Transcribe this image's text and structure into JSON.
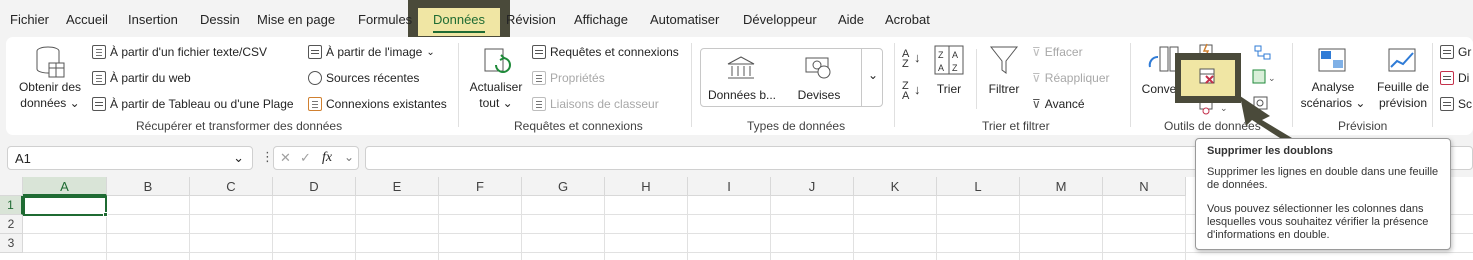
{
  "menu": {
    "tabs": [
      "Fichier",
      "Accueil",
      "Insertion",
      "Dessin",
      "Mise en page",
      "Formules",
      "Données",
      "Révision",
      "Affichage",
      "Automatiser",
      "Développeur",
      "Aide",
      "Acrobat"
    ]
  },
  "ribbon": {
    "get_data": {
      "big_line1": "Obtenir des",
      "big_line2": "données",
      "from_text": "À partir d'un fichier texte/CSV",
      "from_web": "À partir du web",
      "from_table": "À partir de Tableau ou d'une Plage",
      "from_image": "À partir de l'image",
      "recent_sources": "Sources récentes",
      "existing_connections": "Connexions existantes",
      "group_label": "Récupérer et transformer des données"
    },
    "queries": {
      "refresh_line1": "Actualiser",
      "refresh_line2": "tout",
      "queries_connections": "Requêtes et connexions",
      "properties": "Propriétés",
      "workbook_links": "Liaisons de classeur",
      "group_label": "Requêtes et connexions"
    },
    "data_types": {
      "stocks": "Données b...",
      "currencies": "Devises",
      "group_label": "Types de données"
    },
    "sort_filter": {
      "sort": "Trier",
      "filter": "Filtrer",
      "clear": "Effacer",
      "reapply": "Réappliquer",
      "advanced": "Avancé",
      "group_label": "Trier et filtrer"
    },
    "data_tools": {
      "convert": "Convertir",
      "group_label": "Outils de données"
    },
    "forecast": {
      "whatif_line1": "Analyse",
      "whatif_line2": "scénarios",
      "sheet_line1": "Feuille de",
      "sheet_line2": "prévision",
      "group_label": "Prévision"
    },
    "outline": {
      "group_items": [
        "Gr",
        "Di",
        "Sc"
      ]
    }
  },
  "formula_bar": {
    "name_box": "A1",
    "fx": "fx",
    "formula": ""
  },
  "grid": {
    "columns": [
      "A",
      "B",
      "C",
      "D",
      "E",
      "F",
      "G",
      "H",
      "I",
      "J",
      "K",
      "L",
      "M",
      "N"
    ],
    "rows": [
      "1",
      "2",
      "3"
    ]
  },
  "tooltip": {
    "title": "Supprimer les doublons",
    "para1": "Supprimer les lignes en double dans une feuille de données.",
    "para2": "Vous pouvez sélectionner les colonnes dans lesquelles vous souhaitez vérifier la présence d'informations en double."
  },
  "colors": {
    "accent_green": "#1f6b33",
    "highlight_yellow": "#f0e6a4",
    "highlight_frame": "#4a4a3a"
  }
}
